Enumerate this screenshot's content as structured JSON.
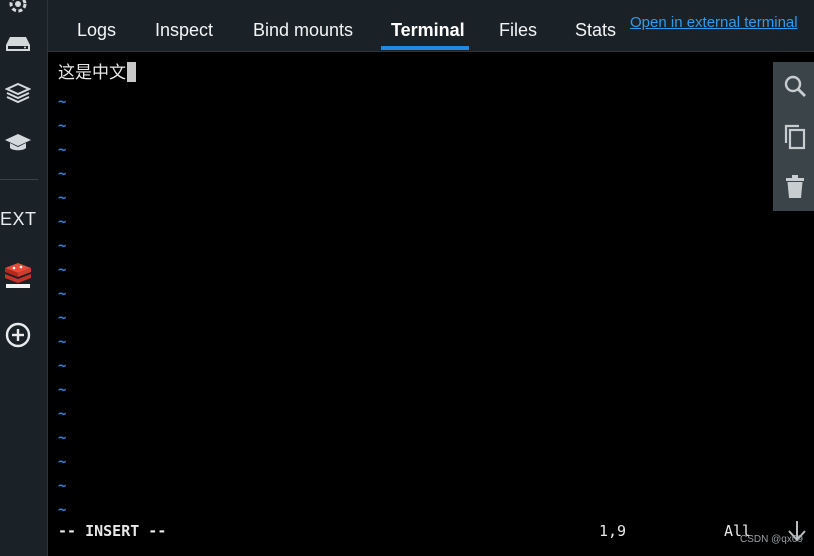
{
  "tabs": [
    {
      "label": "Logs"
    },
    {
      "label": "Inspect"
    },
    {
      "label": "Bind mounts"
    },
    {
      "label": "Terminal"
    },
    {
      "label": "Files"
    },
    {
      "label": "Stats"
    }
  ],
  "active_tab": "Terminal",
  "external_link": "Open in external terminal",
  "sidebar": {
    "ext_label": "EXT",
    "icons": [
      "settings-icon",
      "drive-icon",
      "volumes-icon",
      "learning-center-icon",
      "redis-enterprise-icon",
      "add-extension-icon"
    ]
  },
  "terminal": {
    "line1": "这是中文",
    "tilde": "~",
    "tilde_count": 18,
    "mode": "-- INSERT --",
    "position": "1,9",
    "scroll": "All"
  },
  "toolbar": {
    "icons": [
      "search-icon",
      "copy-icon",
      "trash-icon"
    ]
  },
  "watermark": "CSDN @qx09",
  "colors": {
    "accent": "#1f8ae3",
    "link": "#2d9cf0",
    "tilde": "#2f84e8",
    "chrome_bg": "#1b2227",
    "toolbar_bg": "#3a4449"
  }
}
